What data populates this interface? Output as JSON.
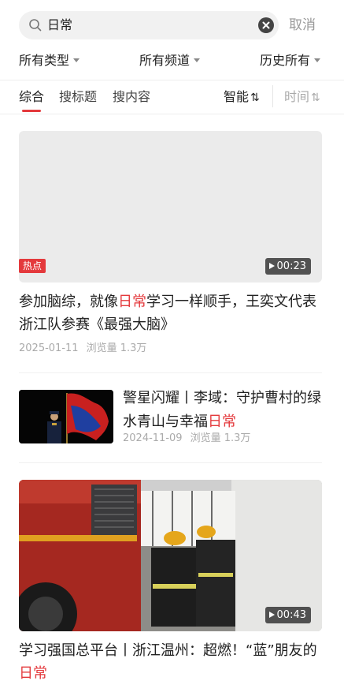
{
  "search": {
    "query": "日常",
    "cancel_label": "取消"
  },
  "filters": [
    {
      "label": "所有类型"
    },
    {
      "label": "所有频道"
    },
    {
      "label": "历史所有"
    }
  ],
  "tabs": [
    {
      "label": "综合",
      "active": true
    },
    {
      "label": "搜标题",
      "active": false
    },
    {
      "label": "搜内容",
      "active": false
    }
  ],
  "sort": {
    "smart_label": "智能",
    "time_label": "时间",
    "arrow": "⇅"
  },
  "colors": {
    "accent": "#e4393c",
    "muted": "#aaaaaa"
  },
  "articles": [
    {
      "badge": "热点",
      "duration": "00:23",
      "title_pre": "参加脑综，就像",
      "title_hl": "日常",
      "title_post": "学习一样顺手，王奕文代表浙江队参赛《最强大脑》",
      "date": "2025-01-11",
      "views_label": "浏览量",
      "views": "1.3万"
    },
    {
      "title_pre": "警星闪耀丨李域：守护曹村的绿水青山与幸福",
      "title_hl": "日常",
      "title_post": "",
      "date": "2024-11-09",
      "views_label": "浏览量",
      "views": "1.3万"
    },
    {
      "duration": "00:43",
      "title_pre": "学习强国总平台丨浙江温州：超燃！“蓝”朋友的",
      "title_hl": "日常",
      "title_post": ""
    }
  ]
}
